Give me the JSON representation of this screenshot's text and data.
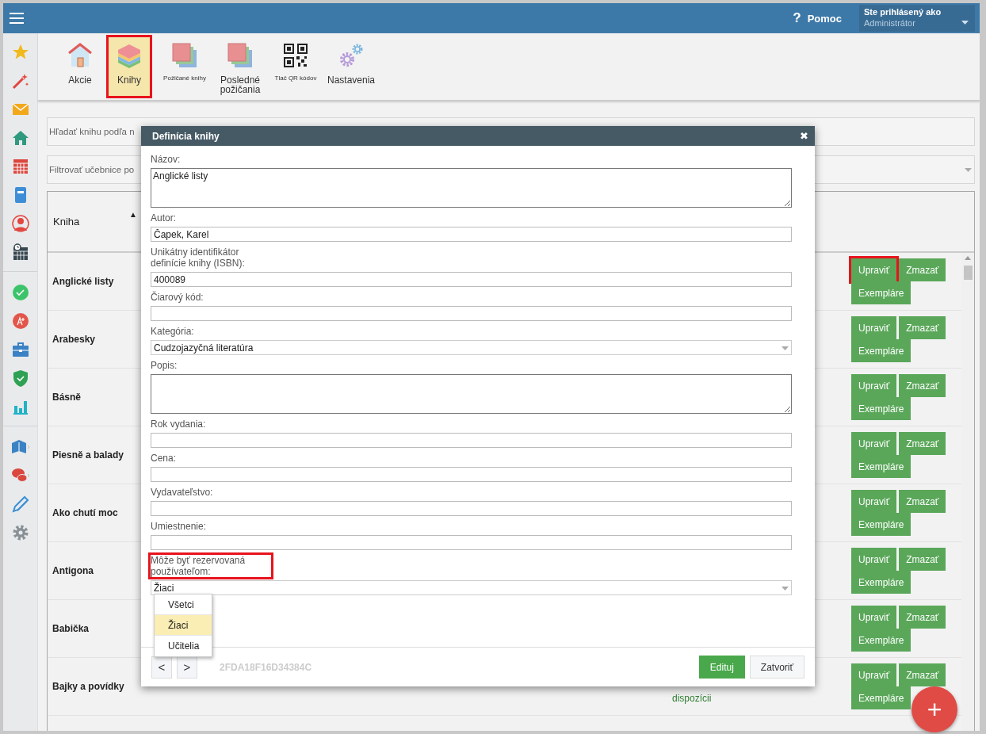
{
  "top_bar": {
    "help_icon": "?",
    "help": "Pomoc",
    "user_label": "Ste prihlásený ako",
    "user_name": "Administrátor"
  },
  "toolbar": [
    {
      "kind": "house",
      "label": "Akcie",
      "small": false,
      "selected": false,
      "highlighted": false
    },
    {
      "kind": "layers",
      "label": "Knihy",
      "small": false,
      "selected": true,
      "highlighted": true
    },
    {
      "kind": "squares",
      "label": "Požičané knihy",
      "small": true,
      "selected": false,
      "highlighted": false
    },
    {
      "kind": "squares",
      "label": "Posledné požičania",
      "small": false,
      "selected": false,
      "highlighted": false
    },
    {
      "kind": "qr",
      "label": "Tlač QR kódov",
      "small": true,
      "selected": false,
      "highlighted": false
    },
    {
      "kind": "gears",
      "label": "Nastavenia",
      "small": false,
      "selected": false,
      "highlighted": false
    }
  ],
  "search": {
    "placeholder": "Hľadať knihu podľa n"
  },
  "filter": {
    "placeholder": "Filtrovať učebnice po"
  },
  "table": {
    "columns": [
      {
        "label": "Kniha",
        "sort_icon": "▲"
      }
    ],
    "rows": [
      {
        "title": "Anglické listy",
        "buttons": [
          "Upraviť",
          "Zmazať",
          "Exempláre"
        ],
        "edit_highlighted": true
      },
      {
        "title": "Arabesky",
        "buttons": [
          "Upraviť",
          "Zmazať",
          "Exempláre"
        ],
        "edit_highlighted": false
      },
      {
        "title": "Básně",
        "buttons": [
          "Upraviť",
          "Zmazať",
          "Exempláre"
        ],
        "edit_highlighted": false
      },
      {
        "title": "Piesně a balady",
        "buttons": [
          "Upraviť",
          "Zmazať",
          "Exempláre"
        ],
        "edit_highlighted": false
      },
      {
        "title": "Ako chutí moc",
        "buttons": [
          "Upraviť",
          "Zmazať",
          "Exempláre"
        ],
        "edit_highlighted": false
      },
      {
        "title": "Antigona",
        "buttons": [
          "Upraviť",
          "Zmazať",
          "Exempláre"
        ],
        "edit_highlighted": false
      },
      {
        "title": "Babička",
        "buttons": [
          "Upraviť",
          "Zmazať",
          "Exempláre"
        ],
        "edit_highlighted": false
      },
      {
        "title": "Bajky a povídky",
        "status": "dispozícii",
        "buttons": [
          "Upraviť",
          "Zmazať",
          "Exempláre"
        ],
        "edit_highlighted": false
      }
    ]
  },
  "add_button": "+",
  "modal": {
    "title": "Definícia knihy",
    "close": "✖",
    "fields": [
      {
        "kind": "textarea",
        "label": "Názov:",
        "value": "Anglické listy",
        "highlighted": false
      },
      {
        "kind": "input",
        "label": "Autor:",
        "value": "Čapek, Karel",
        "highlighted": false
      },
      {
        "kind": "input",
        "label": "Unikátny identifikátor definície knihy (ISBN):",
        "value": "400089",
        "highlighted": false
      },
      {
        "kind": "input",
        "label": "Čiarový kód:",
        "highlighted": false
      },
      {
        "kind": "select",
        "label": "Kategória:",
        "value": "Cudzojazyčná literatúra",
        "highlighted": false
      },
      {
        "kind": "textarea",
        "label": "Popis:",
        "highlighted": false
      },
      {
        "kind": "input",
        "label": "Rok vydania:",
        "highlighted": false
      },
      {
        "kind": "input",
        "label": "Cena:",
        "highlighted": false
      },
      {
        "kind": "input",
        "label": "Vydavateľstvo:",
        "highlighted": false
      },
      {
        "kind": "input",
        "label": "Umiestnenie:",
        "highlighted": false
      },
      {
        "kind": "select",
        "label": "Môže byť rezervovaná používateľom:",
        "value": "Žiaci",
        "highlighted": true,
        "options": [
          {
            "label": "Všetci",
            "selected": false
          },
          {
            "label": "Žiaci",
            "selected": true
          },
          {
            "label": "Učitelia",
            "selected": false
          }
        ]
      }
    ],
    "prev": "<",
    "next": ">",
    "code": "2FDA18F16D34384C",
    "buttons": [
      {
        "kind": "primary",
        "label": "Edituj"
      },
      {
        "kind": "default",
        "label": "Zatvoriť"
      }
    ]
  }
}
